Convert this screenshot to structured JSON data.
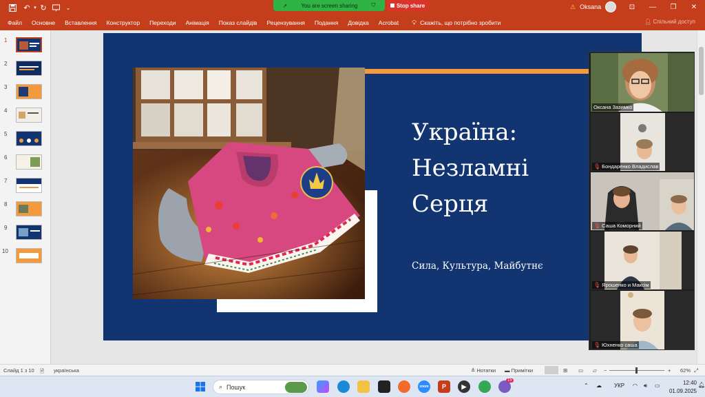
{
  "titlebar": {
    "screen_sharing_text": "You are screen sharing",
    "stop_share_label": "Stop share",
    "user_name": "Oksana",
    "warning_icon": "warning-icon"
  },
  "menu": {
    "items": [
      "Файл",
      "Основне",
      "Вставлення",
      "Конструктор",
      "Переходи",
      "Анімація",
      "Показ слайдів",
      "Рецензування",
      "Подання",
      "Довідка",
      "Acrobat"
    ],
    "search_text": "Скажіть, що потрібно зробити",
    "share_label": "Спільний доступ"
  },
  "thumbnails": {
    "numbers": [
      "1",
      "2",
      "3",
      "4",
      "5",
      "6",
      "7",
      "8",
      "9",
      "10"
    ],
    "active_index": 1
  },
  "slide": {
    "title_line1": "Україна:",
    "title_line2": "Незламні",
    "title_line3": "Серця",
    "subtitle": "Сила, Культура, Майбутнє",
    "background_color": "#123571",
    "accent_color": "#f29a3c"
  },
  "participants": [
    {
      "name": "Оксана Зазимко",
      "muted": false
    },
    {
      "name": "Бондаренко Владислав",
      "muted": true
    },
    {
      "name": "Саша Коморний",
      "muted": true
    },
    {
      "name": "Ярошенко и Максім",
      "muted": true
    },
    {
      "name": "Юхненко саша",
      "muted": true
    }
  ],
  "statusbar": {
    "slide_counter": "Слайд 1 з 10",
    "language": "українська",
    "notes_label": "Нотатки",
    "comments_label": "Примітки",
    "zoom": "62%"
  },
  "taskbar": {
    "search_placeholder": "Пошук",
    "language": "УКР",
    "time": "12:40",
    "date": "01.09.2025",
    "notification_badge": "15"
  }
}
